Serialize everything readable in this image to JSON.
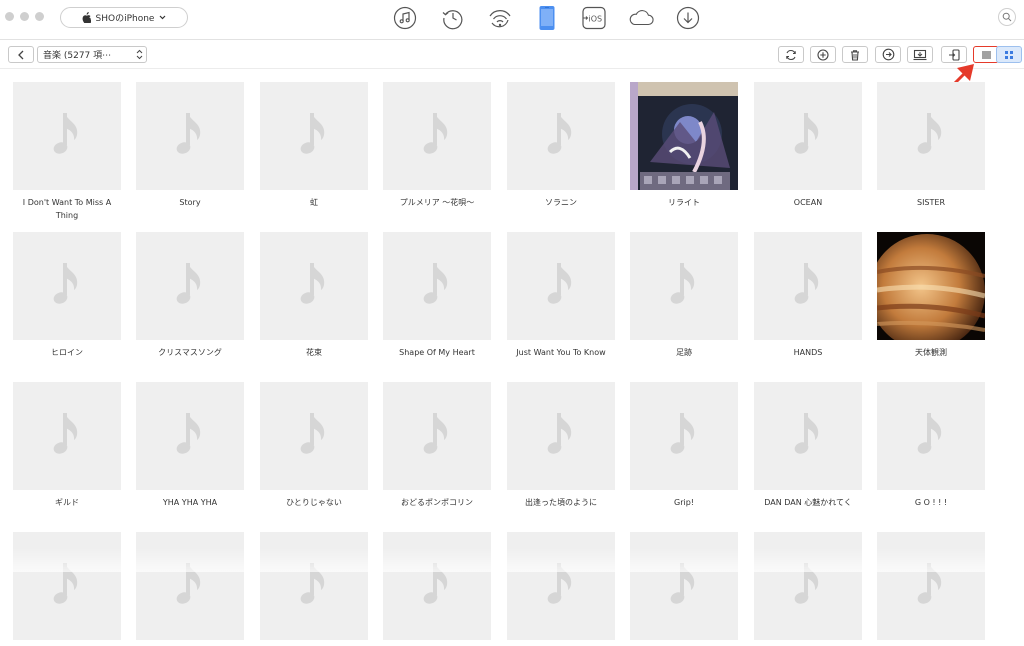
{
  "window": {
    "device_name": "SHOのiPhone",
    "traffic_lights": [
      "close",
      "minimize",
      "zoom"
    ]
  },
  "toolbar": {
    "icons": [
      "music-library-icon",
      "history-icon",
      "air-backup-icon",
      "device-icon",
      "ios-mover-icon",
      "icloud-icon",
      "download-icon"
    ],
    "search_icon": "search-icon"
  },
  "subtoolbar": {
    "category": "音楽 (5277 項⋯",
    "actions": [
      "refresh-icon",
      "add-icon",
      "delete-icon",
      "to-itunes-icon",
      "to-computer-icon",
      "to-device-icon"
    ],
    "view_modes": [
      "list-view-icon",
      "grid-view-icon"
    ],
    "active_view": "grid"
  },
  "colors": {
    "accent": "#3b7be0",
    "highlight_border": "#e53a2a",
    "tile_bg": "#efefef",
    "note_color": "#d6d6d6"
  },
  "songs": [
    {
      "title": "I Don't Want To Miss A Thing",
      "art": "placeholder"
    },
    {
      "title": "Story",
      "art": "placeholder"
    },
    {
      "title": "虹",
      "art": "placeholder"
    },
    {
      "title": "プルメリア 〜花唄〜",
      "art": "placeholder"
    },
    {
      "title": "ソラニン",
      "art": "placeholder"
    },
    {
      "title": "リライト",
      "art": "album-cover"
    },
    {
      "title": "OCEAN",
      "art": "placeholder"
    },
    {
      "title": "SISTER",
      "art": "placeholder"
    },
    {
      "title": "ヒロイン",
      "art": "placeholder"
    },
    {
      "title": "クリスマスソング",
      "art": "placeholder"
    },
    {
      "title": "花束",
      "art": "placeholder"
    },
    {
      "title": "Shape Of My Heart",
      "art": "placeholder"
    },
    {
      "title": "Just Want You To Know",
      "art": "placeholder"
    },
    {
      "title": "足跡",
      "art": "placeholder"
    },
    {
      "title": "HANDS",
      "art": "placeholder"
    },
    {
      "title": "天体観測",
      "art": "jupiter-cover"
    },
    {
      "title": "ギルド",
      "art": "placeholder"
    },
    {
      "title": "YHA YHA YHA",
      "art": "placeholder"
    },
    {
      "title": "ひとりじゃない",
      "art": "placeholder"
    },
    {
      "title": "おどるポンポコリン",
      "art": "placeholder"
    },
    {
      "title": "出逢った頃のように",
      "art": "placeholder"
    },
    {
      "title": "Grip!",
      "art": "placeholder"
    },
    {
      "title": "DAN DAN 心魅かれてく",
      "art": "placeholder"
    },
    {
      "title": "G O ! ! !",
      "art": "placeholder"
    },
    {
      "title": "",
      "art": "placeholder"
    },
    {
      "title": "",
      "art": "placeholder"
    },
    {
      "title": "",
      "art": "placeholder"
    },
    {
      "title": "",
      "art": "placeholder"
    },
    {
      "title": "",
      "art": "placeholder"
    },
    {
      "title": "",
      "art": "placeholder"
    },
    {
      "title": "",
      "art": "placeholder"
    },
    {
      "title": "",
      "art": "placeholder"
    }
  ]
}
